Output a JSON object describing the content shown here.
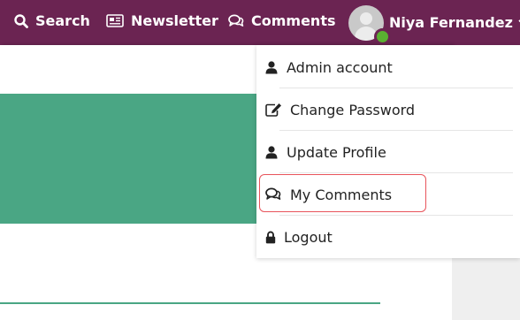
{
  "nav": {
    "search_label": "Search",
    "newsletter_label": "Newsletter",
    "comments_label": "Comments",
    "user_name": "Niya Fernandez",
    "icons": [
      "search-icon",
      "newspaper-icon",
      "comments-icon",
      "avatar",
      "chevron-down-icon"
    ]
  },
  "status": {
    "online": true,
    "color": "#5ab031"
  },
  "dropdown": {
    "items": [
      {
        "label": "Admin account",
        "icon": "user-icon"
      },
      {
        "label": "Change Password",
        "icon": "edit-icon"
      },
      {
        "label": "Update Profile",
        "icon": "user-icon"
      },
      {
        "label": "My Comments",
        "icon": "comments-icon",
        "highlighted": true
      },
      {
        "label": "Logout",
        "icon": "lock-icon"
      }
    ]
  },
  "colors": {
    "topbar": "#6b2452",
    "accent_green": "#4aa684",
    "highlight_border": "#e8545b"
  }
}
